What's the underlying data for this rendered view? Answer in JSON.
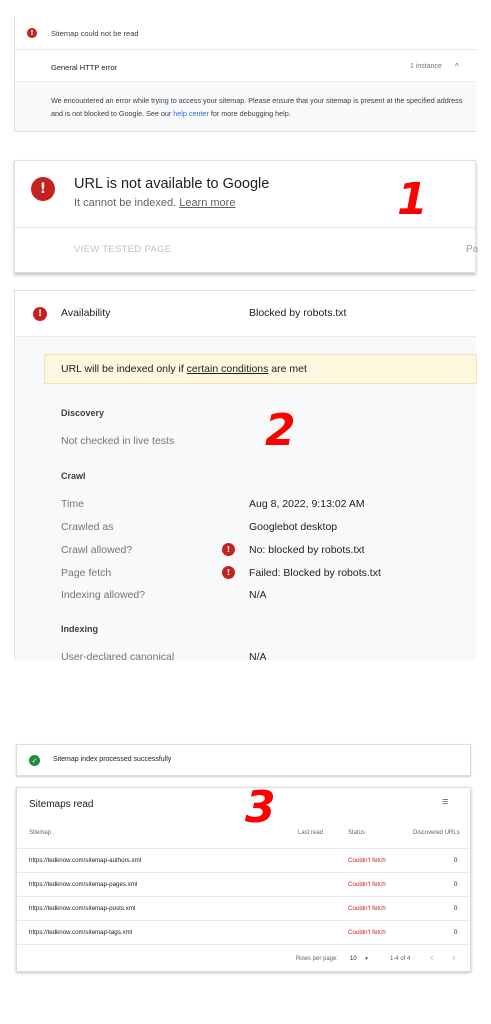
{
  "section1": {
    "title": "Sitemap could not be read",
    "error_type": "General HTTP error",
    "instances": "1 instance",
    "desc_before": "We encountered an error while trying to access your sitemap. Please ensure that your sitemap is present at the specified address and is not blocked to Google. See our ",
    "desc_link": "help center",
    "desc_after": " for more debugging help.",
    "error_mark": "!",
    "chevron": "^"
  },
  "card1": {
    "title": "URL is not available to Google",
    "subtitle": "It cannot be indexed.",
    "learn_more": "Learn more",
    "view_tested": "VIEW TESTED PAGE",
    "cutoff": "Pa",
    "marker": "1"
  },
  "card2": {
    "availability_label": "Availability",
    "availability_value": "Blocked by robots.txt",
    "banner_before": "URL will be indexed only if ",
    "banner_link": "certain conditions",
    "banner_after": " are met",
    "discovery_head": "Discovery",
    "discovery_text": "Not checked in live tests",
    "crawl_head": "Crawl",
    "rows": [
      {
        "label": "Time",
        "value": "Aug 8, 2022, 9:13:02 AM"
      },
      {
        "label": "Crawled as",
        "value": "Googlebot desktop"
      },
      {
        "label": "Crawl allowed?",
        "value": "No: blocked by robots.txt"
      },
      {
        "label": "Page fetch",
        "value": "Failed: Blocked by robots.txt"
      },
      {
        "label": "Indexing allowed?",
        "value": "N/A"
      }
    ],
    "indexing_head": "Indexing",
    "canonical_label": "User-declared canonical",
    "canonical_value": "N/A",
    "marker": "2"
  },
  "section3": {
    "ok_text": "Sitemap index processed successfully",
    "ok_mark": "✓",
    "table_title": "Sitemaps read",
    "filter_icon": "≡",
    "marker": "3",
    "headers": {
      "sitemap": "Sitemap",
      "last_read": "Last read",
      "status": "Status",
      "discovered": "Discovered URLs"
    },
    "rows": [
      {
        "sitemap": "https://tedknow.com/sitemap-authors.xml",
        "status": "Couldn't fetch",
        "count": "0"
      },
      {
        "sitemap": "https://tedknow.com/sitemap-pages.xml",
        "status": "Couldn't fetch",
        "count": "0"
      },
      {
        "sitemap": "https://tedknow.com/sitemap-posts.xml",
        "status": "Couldn't fetch",
        "count": "0"
      },
      {
        "sitemap": "https://tedknow.com/sitemap-tags.xml",
        "status": "Couldn't fetch",
        "count": "0"
      }
    ],
    "footer": {
      "rows_label": "Rows per page:",
      "rows_value": "10",
      "dropdown": "▼",
      "range": "1-4 of 4",
      "prev": "‹",
      "next": "›"
    }
  }
}
